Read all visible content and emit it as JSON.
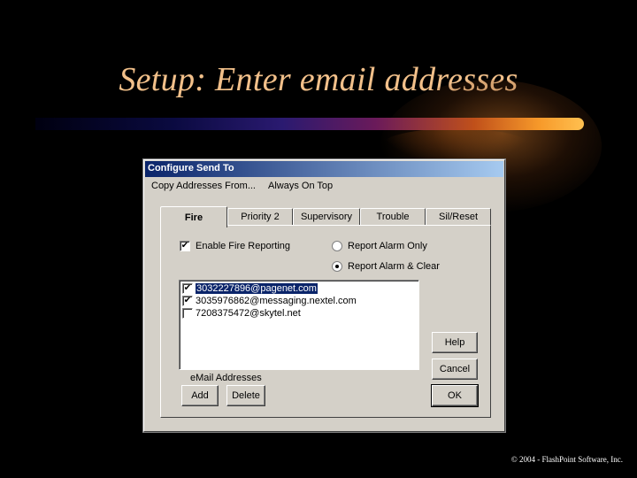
{
  "slide": {
    "title": "Setup:  Enter email addresses",
    "footer": "© 2004 - FlashPoint Software, Inc."
  },
  "dialog": {
    "title": "Configure Send To",
    "menu": [
      "Copy Addresses From...",
      "Always On Top"
    ],
    "tabs": [
      "Fire",
      "Priority 2",
      "Supervisory",
      "Trouble",
      "Sil/Reset"
    ],
    "active_tab": "Fire",
    "enable_label": "Enable Fire Reporting",
    "enable_checked": true,
    "radio_alarm_only": "Report Alarm Only",
    "radio_alarm_clear": "Report Alarm & Clear",
    "radio_selected": "Report Alarm & Clear",
    "addresses": [
      {
        "text": "3032227896@pagenet.com",
        "checked": true,
        "selected": true
      },
      {
        "text": "3035976862@messaging.nextel.com",
        "checked": true,
        "selected": false
      },
      {
        "text": "7208375472@skytel.net",
        "checked": false,
        "selected": false
      }
    ],
    "list_label": "eMail Addresses",
    "buttons": {
      "add": "Add",
      "delete": "Delete",
      "help": "Help",
      "cancel": "Cancel",
      "ok": "OK"
    }
  },
  "colors": {
    "title_text": "#f2c08a",
    "selection": "#0a246a",
    "window_face": "#d4d0c8"
  }
}
